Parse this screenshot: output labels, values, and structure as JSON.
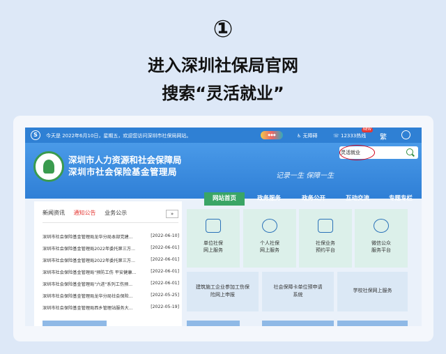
{
  "step": {
    "number": "①"
  },
  "headline": {
    "line1": "进入深圳社保局官网",
    "line2": "搜索“灵活就业”"
  },
  "topbar": {
    "logo": "S",
    "welcome": "今天是 2022年6月10日，星期五，欢迎您访问深圳市社保局网站。",
    "accessibility": "无障碍",
    "hotline": "12333热线",
    "hotline_badge": "NEW",
    "traditional": "繁",
    "colors": {
      "bar": "#2f80d4"
    }
  },
  "header": {
    "org_line1": "深圳市人力资源和社会保障局",
    "org_line2": "深圳市社会保险基金管理局",
    "slogan": "记录一生 保障一生",
    "search_value": "灵活就业",
    "icons": {
      "search": "search-icon",
      "emblem": "emblem-icon"
    }
  },
  "nav": {
    "home": "网站首页",
    "affairs": "政务服务",
    "public": "政务公开",
    "interaction": "互动交流",
    "special": "专题专栏"
  },
  "news": {
    "tabs": [
      "新闻资讯",
      "通知公告",
      "业务公示"
    ],
    "more": "»",
    "items": [
      {
        "title": "深圳市社会保险基金管理局龙华分局本部党建...",
        "date": "[2022-06-10]"
      },
      {
        "title": "深圳市社会保险基金管理局2022年委托第三方...",
        "date": "[2022-06-01]"
      },
      {
        "title": "深圳市社会保险基金管理局2022年委托第三方...",
        "date": "[2022-06-01]"
      },
      {
        "title": "深圳市社会保险基金管理局\"预防工伤 平安健康...",
        "date": "[2022-06-01]"
      },
      {
        "title": "深圳市社会保险基金管理局\"六进\"系列工伤预...",
        "date": "[2022-06-01]"
      },
      {
        "title": "深圳市社会保险基金管理局龙华分局社会保险...",
        "date": "[2022-05-25]"
      },
      {
        "title": "深圳市社会保险基金管理局西乡管理站服务大...",
        "date": "[2022-05-19]"
      }
    ]
  },
  "services": {
    "tiles": [
      {
        "line1": "单位社保",
        "line2": "网上服务",
        "icon": "building-icon"
      },
      {
        "line1": "个人社保",
        "line2": "网上服务",
        "icon": "person-icon"
      },
      {
        "line1": "社保业务",
        "line2": "预约平台",
        "icon": "calendar-icon"
      },
      {
        "line1": "微信公众",
        "line2": "服务平台",
        "icon": "wechat-icon"
      }
    ],
    "wide": [
      {
        "line1": "建筑施工企业参加工伤保",
        "line2": "险网上申报"
      },
      {
        "line1": "社会保障卡单位预申请",
        "line2": "系统"
      },
      {
        "line1": "学校社保网上服务",
        "line2": ""
      }
    ]
  }
}
